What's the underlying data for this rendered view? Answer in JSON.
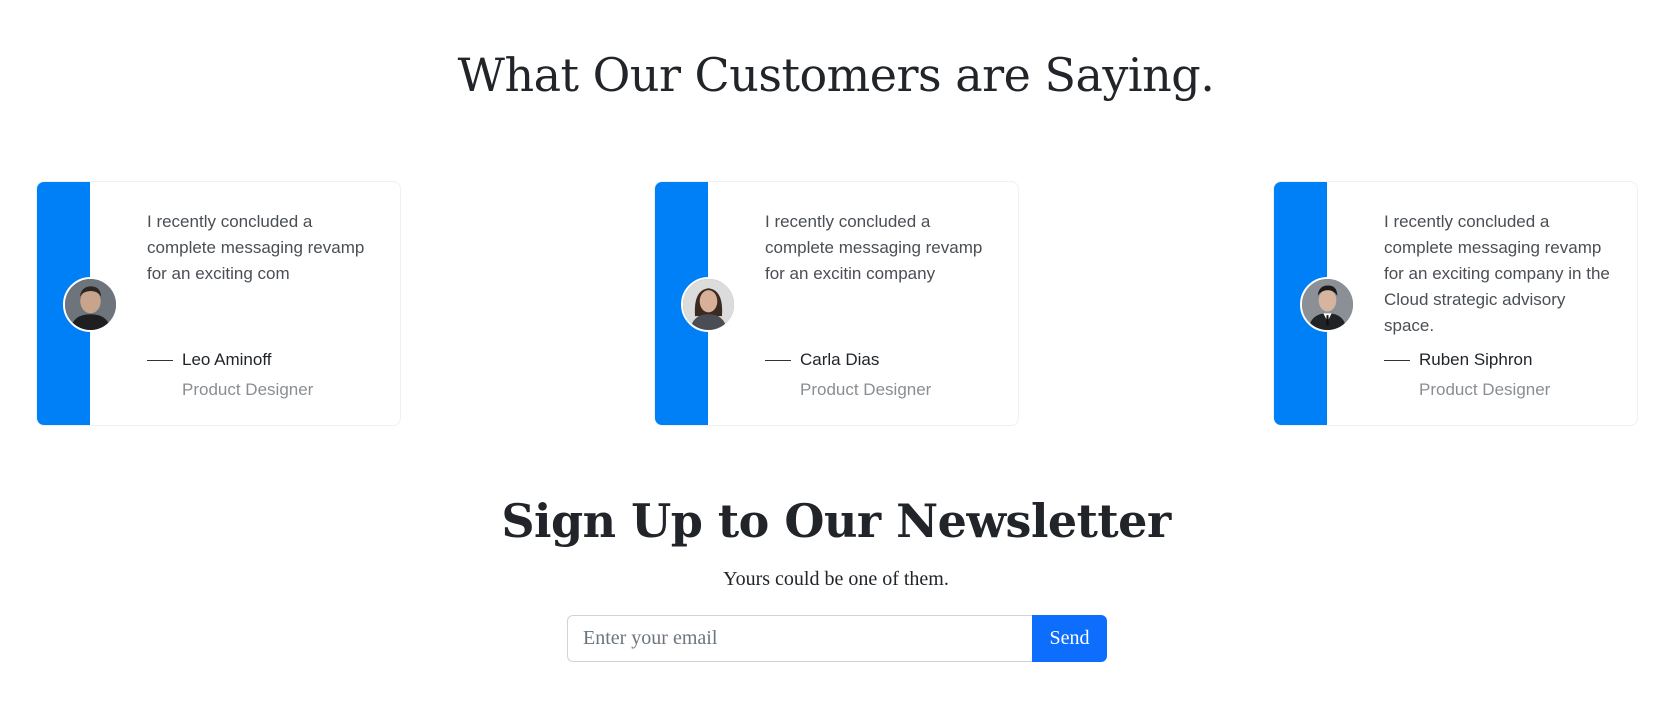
{
  "testimonials_section": {
    "title": "What Our Customers are Saying."
  },
  "testimonials": [
    {
      "quote": "I recently concluded a complete messaging revamp for an exciting com",
      "name": "Leo Aminoff",
      "role": "Product Designer",
      "avatar": "man-portrait"
    },
    {
      "quote": "I recently concluded a complete messaging revamp for an excitin company",
      "name": "Carla Dias",
      "role": "Product Designer",
      "avatar": "woman-portrait"
    },
    {
      "quote": "I recently concluded a complete messaging revamp for an exciting company in the Cloud strategic advisory space.",
      "name": "Ruben Siphron",
      "role": "Product Designer",
      "avatar": "man-suit-portrait"
    }
  ],
  "newsletter": {
    "title": "Sign Up to Our Newsletter",
    "subtitle": "Yours could be one of them.",
    "email_placeholder": "Enter your email",
    "email_value": "",
    "send_label": "Send"
  },
  "colors": {
    "accent_bar": "#0080f6",
    "button": "#0d6efd"
  }
}
